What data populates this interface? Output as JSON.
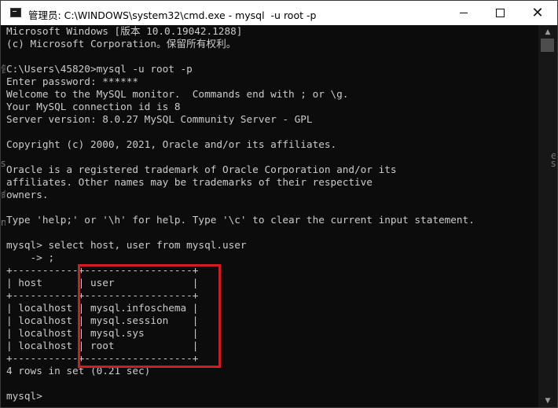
{
  "window": {
    "title": "管理员: C:\\WINDOWS\\system32\\cmd.exe - mysql  -u root -p",
    "icon": "cmd-icon",
    "controls": [
      "minimize",
      "maximize",
      "close"
    ]
  },
  "console": {
    "lines": [
      "Microsoft Windows [版本 10.0.19042.1288]",
      "(c) Microsoft Corporation。保留所有权利。",
      "",
      "C:\\Users\\45820>mysql -u root -p",
      "Enter password: ******",
      "Welcome to the MySQL monitor.  Commands end with ; or \\g.",
      "Your MySQL connection id is 8",
      "Server version: 8.0.27 MySQL Community Server - GPL",
      "",
      "Copyright (c) 2000, 2021, Oracle and/or its affiliates.",
      "",
      "Oracle is a registered trademark of Oracle Corporation and/or its",
      "affiliates. Other names may be trademarks of their respective",
      "owners.",
      "",
      "Type 'help;' or '\\h' for help. Type '\\c' to clear the current input statement.",
      "",
      "mysql> select host, user from mysql.user",
      "    -> ;",
      "+-----------+------------------+",
      "| host      | user             |",
      "+-----------+------------------+",
      "| localhost | mysql.infoschema |",
      "| localhost | mysql.session    |",
      "| localhost | mysql.sys        |",
      "| localhost | root             |",
      "+-----------+------------------+",
      "4 rows in set (0.21 sec)",
      "",
      "mysql>"
    ]
  },
  "edges": {
    "left": [
      "告",
      "s",
      "命",
      "m"
    ],
    "right": [
      "e",
      "s"
    ]
  },
  "scrollbar": {
    "up": "▲",
    "down": "▼"
  },
  "close_glyph": "✕"
}
